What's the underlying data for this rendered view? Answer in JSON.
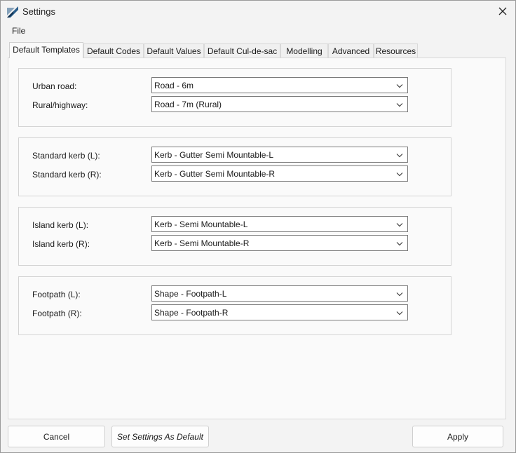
{
  "window": {
    "title": "Settings"
  },
  "menu": {
    "file": "File"
  },
  "tabs": [
    {
      "label": "Default Templates",
      "active": true
    },
    {
      "label": "Default Codes",
      "active": false
    },
    {
      "label": "Default Values",
      "active": false
    },
    {
      "label": "Default Cul-de-sac",
      "active": false
    },
    {
      "label": "Modelling",
      "active": false
    },
    {
      "label": "Advanced",
      "active": false
    },
    {
      "label": "Resources",
      "active": false
    }
  ],
  "groups": [
    {
      "rows": [
        {
          "label": "Urban road:",
          "value": "Road - 6m"
        },
        {
          "label": "Rural/highway:",
          "value": "Road - 7m (Rural)"
        }
      ]
    },
    {
      "rows": [
        {
          "label": "Standard kerb (L):",
          "value": "Kerb - Gutter Semi Mountable-L"
        },
        {
          "label": "Standard kerb (R):",
          "value": "Kerb - Gutter Semi Mountable-R"
        }
      ]
    },
    {
      "rows": [
        {
          "label": "Island kerb (L):",
          "value": "Kerb - Semi Mountable-L"
        },
        {
          "label": "Island kerb (R):",
          "value": "Kerb - Semi Mountable-R"
        }
      ]
    },
    {
      "rows": [
        {
          "label": "Footpath (L):",
          "value": "Shape - Footpath-L"
        },
        {
          "label": "Footpath (R):",
          "value": "Shape - Footpath-R"
        }
      ]
    }
  ],
  "footer": {
    "cancel": "Cancel",
    "set_default": "Set Settings As Default",
    "apply": "Apply"
  },
  "icons": {
    "app": "app-logo-icon",
    "close": "close-icon",
    "dropdown": "chevron-down-icon"
  }
}
